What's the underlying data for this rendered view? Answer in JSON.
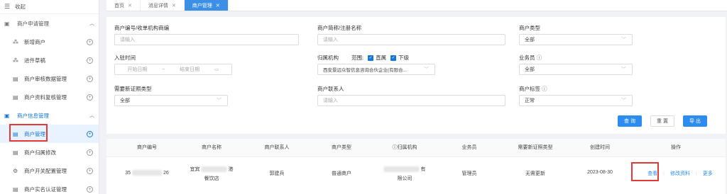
{
  "sidebar": {
    "collapse_label": "收起",
    "groups": [
      {
        "label": "商户申请管理",
        "items": [
          "新增商户",
          "进件草稿",
          "商户审核数据管理",
          "商户资料复核管理"
        ]
      },
      {
        "label": "商户信息管理",
        "items": [
          "商户管理",
          "商户归属修改",
          "商户开关配置管理",
          "商户实名认证管理"
        ]
      }
    ],
    "selected_item": "商户管理"
  },
  "tabs": [
    {
      "label": "首页"
    },
    {
      "label": "消息详情"
    },
    {
      "label": "商户管理"
    }
  ],
  "filters": {
    "merchant_no": {
      "label": "商户编号/收单机构商编",
      "placeholder": "请输入"
    },
    "merchant_name": {
      "label": "商户简称/注册名称",
      "placeholder": "请输入"
    },
    "merchant_type": {
      "label": "商户类型",
      "value": "全部"
    },
    "entry_time": {
      "label": "入驻时间",
      "start_placeholder": "开始日期",
      "separator": "~",
      "end_placeholder": "结束日期"
    },
    "org": {
      "label": "归属机构",
      "scope_label": "范围:",
      "check_direct": "直属",
      "check_sub": "下级",
      "value": "西安景远众智信息咨询合伙企业(有限合..."
    },
    "salesman": {
      "label": "业务员",
      "value": "全部"
    },
    "renew_cert_type": {
      "label": "需要新证照类型",
      "value": "全部"
    },
    "contact": {
      "label": "商户联系人",
      "placeholder": "请输入"
    },
    "merchant_tag": {
      "label": "商户标签",
      "value": "正常"
    }
  },
  "actions": {
    "search": "查 询",
    "reset": "重 置",
    "export": "导 出"
  },
  "table": {
    "columns": [
      "商户编号",
      "商户名称",
      "商户联系人",
      "商户类型",
      "归属机构",
      "业务员",
      "需要新证照类型",
      "创建时间",
      "操作"
    ],
    "rows": [
      {
        "merchant_no_prefix": "35",
        "merchant_no_suffix": "26",
        "name_line1_prefix": "宜宾",
        "name_line1_suffix": "港",
        "name_line2": "餐饮店",
        "contact": "郭建兵",
        "type": "普通商户",
        "org_suffix1": "有",
        "org_line2": "限公司",
        "salesman": "管理员",
        "renew_cert": "无需更新",
        "created": "2023-08-30",
        "op_view": "查看",
        "op_edit": "修改资料",
        "op_more": "更多"
      }
    ]
  },
  "colors": {
    "primary": "#2d8cf0",
    "highlight": "#e53935"
  }
}
